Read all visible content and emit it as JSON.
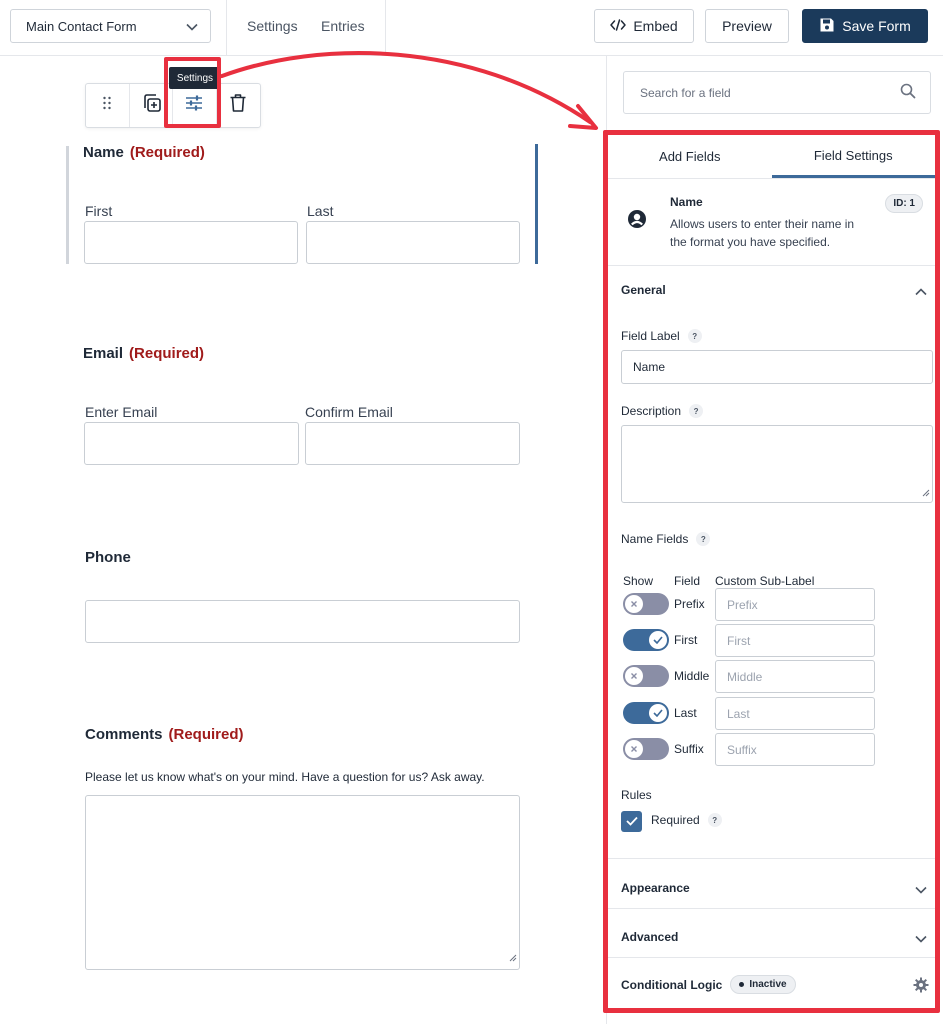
{
  "header": {
    "form_name": "Main Contact Form",
    "nav": [
      "Settings",
      "Entries"
    ],
    "embed_label": "Embed",
    "preview_label": "Preview",
    "save_label": "Save Form"
  },
  "toolbar": {
    "tooltip": "Settings"
  },
  "form": {
    "required_text": "(Required)",
    "name": {
      "label": "Name",
      "first": "First",
      "last": "Last"
    },
    "email": {
      "label": "Email",
      "enter": "Enter Email",
      "confirm": "Confirm Email"
    },
    "phone": {
      "label": "Phone"
    },
    "comments": {
      "label": "Comments",
      "description": "Please let us know what's on your mind. Have a question for us? Ask away."
    }
  },
  "sidebar": {
    "search_placeholder": "Search for a field",
    "tabs": [
      "Add Fields",
      "Field Settings"
    ],
    "field": {
      "title": "Name",
      "description": "Allows users to enter their name in the format you have specified.",
      "id_badge": "ID: 1"
    },
    "general": {
      "heading": "General",
      "field_label_title": "Field Label",
      "field_label_value": "Name",
      "description_title": "Description",
      "name_fields_title": "Name Fields",
      "col_show": "Show",
      "col_field": "Field",
      "col_sublabel": "Custom Sub-Label",
      "rows": [
        {
          "name": "Prefix",
          "on": false,
          "placeholder": "Prefix"
        },
        {
          "name": "First",
          "on": true,
          "placeholder": "First"
        },
        {
          "name": "Middle",
          "on": false,
          "placeholder": "Middle"
        },
        {
          "name": "Last",
          "on": true,
          "placeholder": "Last"
        },
        {
          "name": "Suffix",
          "on": false,
          "placeholder": "Suffix"
        }
      ],
      "rules_title": "Rules",
      "required_label": "Required",
      "required_checked": true
    },
    "appearance": "Appearance",
    "advanced": "Advanced",
    "conditional_logic": "Conditional Logic",
    "conditional_status": "Inactive",
    "help_glyph": "?"
  },
  "colors": {
    "highlight": "#e8303f",
    "primary": "#1b3a5b",
    "accent": "#3d6a9a",
    "required": "#a01b1b"
  }
}
